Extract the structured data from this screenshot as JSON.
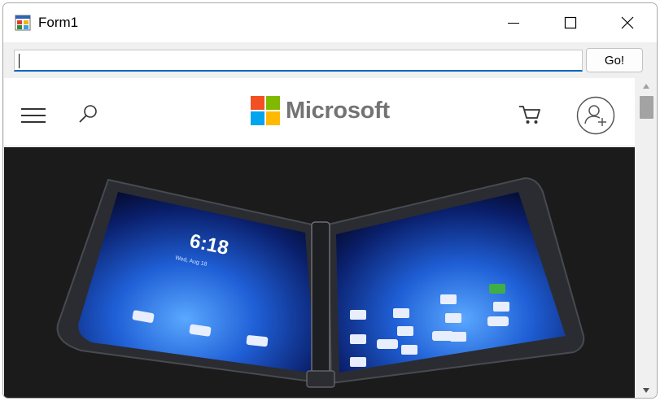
{
  "window": {
    "title": "Form1",
    "icons": {
      "app": "form-app-icon",
      "minimize": "minimize-icon",
      "maximize": "maximize-icon",
      "close": "close-icon"
    }
  },
  "toolbar": {
    "url_value": "",
    "go_label": "Go!"
  },
  "site": {
    "brand": "Microsoft",
    "brand_colors": [
      "#f25022",
      "#7fba00",
      "#00a4ef",
      "#ffb900"
    ],
    "icons": {
      "menu": "hamburger-menu-icon",
      "search": "search-icon",
      "cart": "cart-icon",
      "account": "account-sign-in-icon"
    },
    "hero": {
      "phone_time": "6:18",
      "phone_date": "Wed, Aug 18"
    }
  },
  "colors": {
    "accent": "#0067c0",
    "hero_background": "#1b1b1b"
  }
}
